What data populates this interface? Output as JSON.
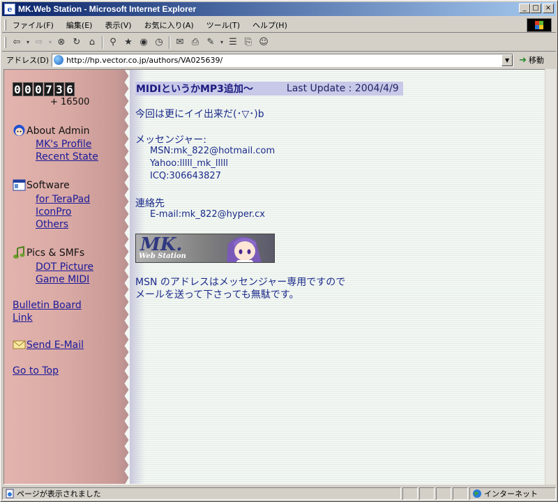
{
  "window": {
    "title": "MK.Web Station - Microsoft Internet Explorer"
  },
  "menu": [
    "ファイル(F)",
    "編集(E)",
    "表示(V)",
    "お気に入り(A)",
    "ツール(T)",
    "ヘルプ(H)"
  ],
  "address": {
    "label": "アドレス(D)",
    "url": "http://hp.vector.co.jp/authors/VA025639/",
    "go_label": "移動"
  },
  "sidebar": {
    "counter_digits": [
      "0",
      "0",
      "0",
      "7",
      "3",
      "6"
    ],
    "counter_offset": "+ 16500",
    "about_header": "About Admin",
    "about_links": [
      "MK's Profile",
      "Recent State"
    ],
    "software_header": "Software",
    "software_links": [
      "for TeraPad",
      "IconPro",
      "Others"
    ],
    "pics_header": "Pics & SMFs",
    "pics_links": [
      "DOT Picture",
      "Game MIDI"
    ],
    "bulletin": "Bulletin Board",
    "link": "Link",
    "send_mail": "Send E-Mail",
    "go_top": "Go to Top"
  },
  "main": {
    "headline_title": "MIDIというかMP3追加～",
    "headline_update": "Last Update : 2004/4/9",
    "line1": "今回は更にイイ出来だ(･▽･)b",
    "messenger_header": "メッセンジャー:",
    "msn": "MSN:mk_822@hotmail.com",
    "yahoo": "Yahoo:lllll_mk_lllll",
    "icq": "ICQ:306643827",
    "contact_header": "連絡先",
    "email": "E-mail:mk_822@hyper.cx",
    "banner_title": "MK.",
    "banner_sub": "Web Station",
    "note1": "MSN のアドレスはメッセンジャー専用ですので",
    "note2": "メールを送って下さっても無駄です。"
  },
  "status": {
    "text": "ページが表示されました",
    "zone": "インターネット"
  }
}
